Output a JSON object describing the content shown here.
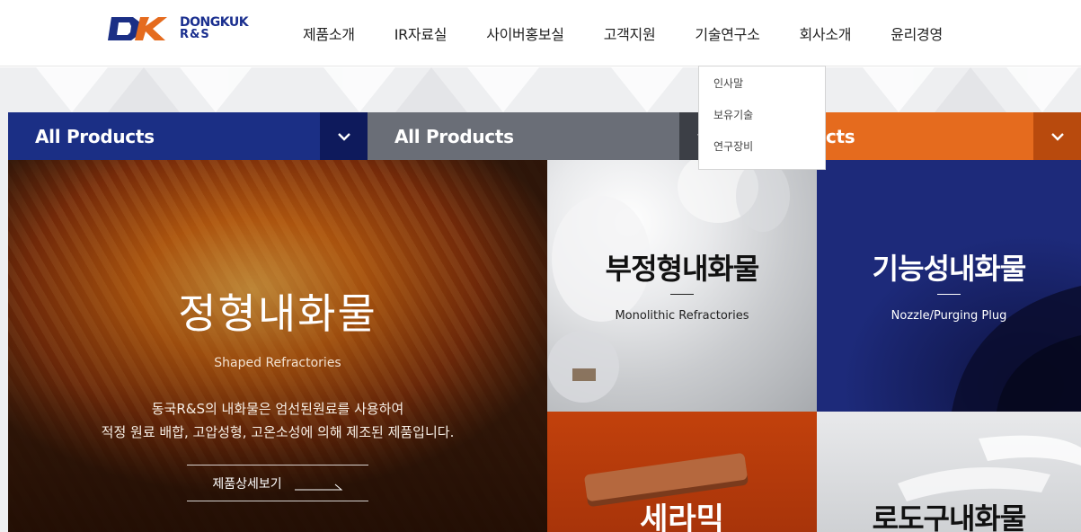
{
  "brand": {
    "name_line1": "DONGKUK",
    "name_line2": "R&S",
    "mark_color": "#1b2f85",
    "accent_color": "#e56b1e"
  },
  "nav": {
    "items": [
      "제품소개",
      "IR자료실",
      "사이버홍보실",
      "고객지원",
      "기술연구소",
      "회사소개",
      "윤리경영"
    ]
  },
  "submenu": {
    "items": [
      "인사말",
      "보유기술",
      "연구장비"
    ]
  },
  "selectors": [
    {
      "label": "All Products",
      "color": "#1b2f85"
    },
    {
      "label": "All Products",
      "color": "#6a6e77"
    },
    {
      "label": "ucts",
      "color": "#e56b1e"
    }
  ],
  "panels": {
    "shaped": {
      "title": "정형내화물",
      "subtitle": "Shaped Refractories",
      "desc_line1": "동국R&S의 내화물은 엄선된원료를 사용하여",
      "desc_line2": "적정 원료 배합, 고압성형, 고온소성에 의해 제조된 제품입니다.",
      "button": "제품상세보기"
    },
    "monolithic": {
      "title": "부정형내화물",
      "subtitle": "Monolithic Refractories"
    },
    "functional": {
      "title": "기능성내화물",
      "subtitle": "Nozzle/Purging Plug"
    },
    "ceramic": {
      "title": "세라믹"
    },
    "furnace": {
      "title": "로도구내화물"
    }
  }
}
